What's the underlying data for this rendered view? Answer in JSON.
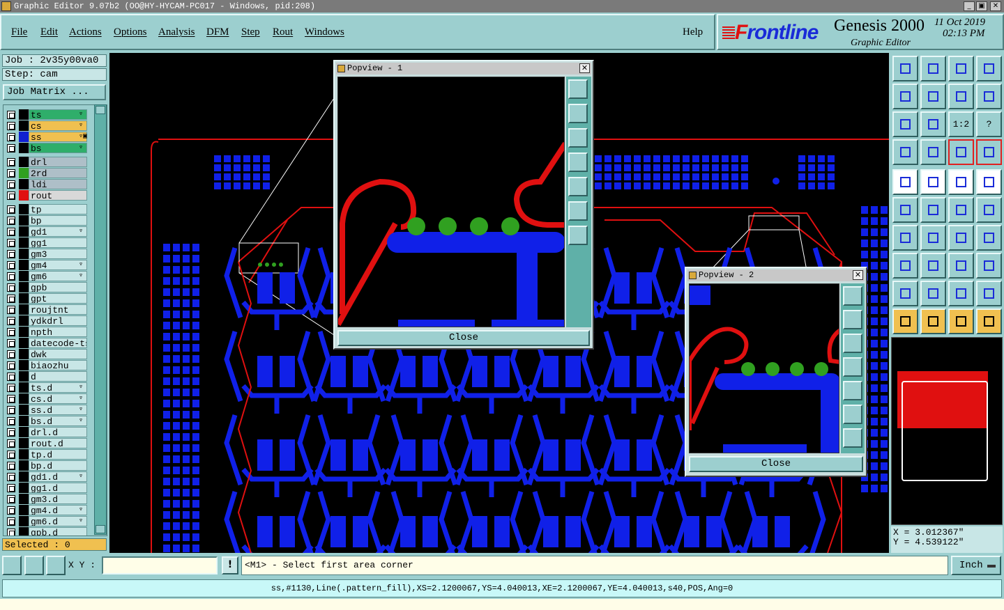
{
  "window": {
    "title": "Graphic Editor 9.07b2 (OO@HY-HYCAM-PC017 - Windows, pid:208)"
  },
  "menubar": {
    "items": [
      "File",
      "Edit",
      "Actions",
      "Options",
      "Analysis",
      "DFM",
      "Step",
      "Rout",
      "Windows"
    ],
    "help": "Help"
  },
  "brand": {
    "logo_prefix": "F",
    "logo": "rontline",
    "product": "Genesis 2000",
    "subtitle": "Graphic Editor",
    "date": "11 Oct 2019",
    "time": "02:13 PM"
  },
  "job": {
    "job_label": "Job : 2v35y00va0",
    "step_label": "Step: cam",
    "job_matrix": "Job Matrix ..."
  },
  "layers": [
    {
      "name": "ts",
      "bg": "#2fae6a",
      "swatch": "",
      "mark": "▿"
    },
    {
      "name": "cs",
      "bg": "#f0c050",
      "swatch": "",
      "mark": "▿"
    },
    {
      "name": "ss",
      "bg": "#f0c050",
      "swatch": "#1020d0",
      "mark": "▿▣"
    },
    {
      "name": "bs",
      "bg": "#2fae6a",
      "swatch": "",
      "mark": "▿"
    },
    {
      "name": "drl",
      "bg": "#aebfc8",
      "swatch": "",
      "mark": ""
    },
    {
      "name": "2rd",
      "bg": "#aebfc8",
      "swatch": "#30a020",
      "mark": ""
    },
    {
      "name": "ldi",
      "bg": "#aebfc8",
      "swatch": "",
      "mark": ""
    },
    {
      "name": "rout",
      "bg": "#d8d8d8",
      "swatch": "#e01010",
      "mark": ""
    },
    {
      "name": "tp",
      "bg": "#c8e6e6",
      "swatch": "",
      "mark": ""
    },
    {
      "name": "bp",
      "bg": "#c8e6e6",
      "swatch": "",
      "mark": ""
    },
    {
      "name": "gd1",
      "bg": "#c8e6e6",
      "swatch": "",
      "mark": "▿"
    },
    {
      "name": "gg1",
      "bg": "#c8e6e6",
      "swatch": "",
      "mark": ""
    },
    {
      "name": "gm3",
      "bg": "#c8e6e6",
      "swatch": "",
      "mark": ""
    },
    {
      "name": "gm4",
      "bg": "#c8e6e6",
      "swatch": "",
      "mark": "▿"
    },
    {
      "name": "gm6",
      "bg": "#c8e6e6",
      "swatch": "",
      "mark": "▿"
    },
    {
      "name": "gpb",
      "bg": "#c8e6e6",
      "swatch": "",
      "mark": ""
    },
    {
      "name": "gpt",
      "bg": "#c8e6e6",
      "swatch": "",
      "mark": ""
    },
    {
      "name": "roujtnt",
      "bg": "#c8e6e6",
      "swatch": "",
      "mark": ""
    },
    {
      "name": "ydkdrl",
      "bg": "#c8e6e6",
      "swatch": "",
      "mark": ""
    },
    {
      "name": "npth",
      "bg": "#c8e6e6",
      "swatch": "",
      "mark": ""
    },
    {
      "name": "datecode-ts",
      "bg": "#c8e6e6",
      "swatch": "",
      "mark": ""
    },
    {
      "name": "dwk",
      "bg": "#c8e6e6",
      "swatch": "",
      "mark": ""
    },
    {
      "name": "biaozhu",
      "bg": "#c8e6e6",
      "swatch": "",
      "mark": ""
    },
    {
      "name": "d",
      "bg": "#c8e6e6",
      "swatch": "",
      "mark": ""
    },
    {
      "name": "ts.d",
      "bg": "#c8e6e6",
      "swatch": "",
      "mark": "▿"
    },
    {
      "name": "cs.d",
      "bg": "#c8e6e6",
      "swatch": "",
      "mark": "▿"
    },
    {
      "name": "ss.d",
      "bg": "#c8e6e6",
      "swatch": "",
      "mark": "▿"
    },
    {
      "name": "bs.d",
      "bg": "#c8e6e6",
      "swatch": "",
      "mark": "▿"
    },
    {
      "name": "drl.d",
      "bg": "#c8e6e6",
      "swatch": "",
      "mark": ""
    },
    {
      "name": "rout.d",
      "bg": "#c8e6e6",
      "swatch": "",
      "mark": ""
    },
    {
      "name": "tp.d",
      "bg": "#c8e6e6",
      "swatch": "",
      "mark": ""
    },
    {
      "name": "bp.d",
      "bg": "#c8e6e6",
      "swatch": "",
      "mark": ""
    },
    {
      "name": "gd1.d",
      "bg": "#c8e6e6",
      "swatch": "",
      "mark": "▿"
    },
    {
      "name": "gg1.d",
      "bg": "#c8e6e6",
      "swatch": "",
      "mark": ""
    },
    {
      "name": "gm3.d",
      "bg": "#c8e6e6",
      "swatch": "",
      "mark": ""
    },
    {
      "name": "gm4.d",
      "bg": "#c8e6e6",
      "swatch": "",
      "mark": "▿"
    },
    {
      "name": "gm6.d",
      "bg": "#c8e6e6",
      "swatch": "",
      "mark": "▿"
    },
    {
      "name": "gpb.d",
      "bg": "#c8e6e6",
      "swatch": "",
      "mark": ""
    }
  ],
  "selected": "Selected : 0",
  "popview1": {
    "title": "Popview - 1",
    "close": "Close"
  },
  "popview2": {
    "title": "Popview - 2",
    "close": "Close"
  },
  "tools": {
    "scale_label": "1:2",
    "help_label": "?"
  },
  "coords": {
    "x": "X = 3.012367\"",
    "y": "Y = 4.539122\""
  },
  "command": {
    "xy_label": "X Y :",
    "xy_value": "",
    "excl": "!",
    "prompt": "<M1> - Select first area corner",
    "unit": "Inch"
  },
  "status": "ss,#1130,Line(.pattern_fill),XS=2.1200067,YS=4.040013,XE=2.1200067,YE=4.040013,s40,POS,Ang=0",
  "colors": {
    "signal": "#1020e8",
    "rout": "#e01010",
    "pad": "#30a020",
    "panel": "#9ccfcf"
  }
}
